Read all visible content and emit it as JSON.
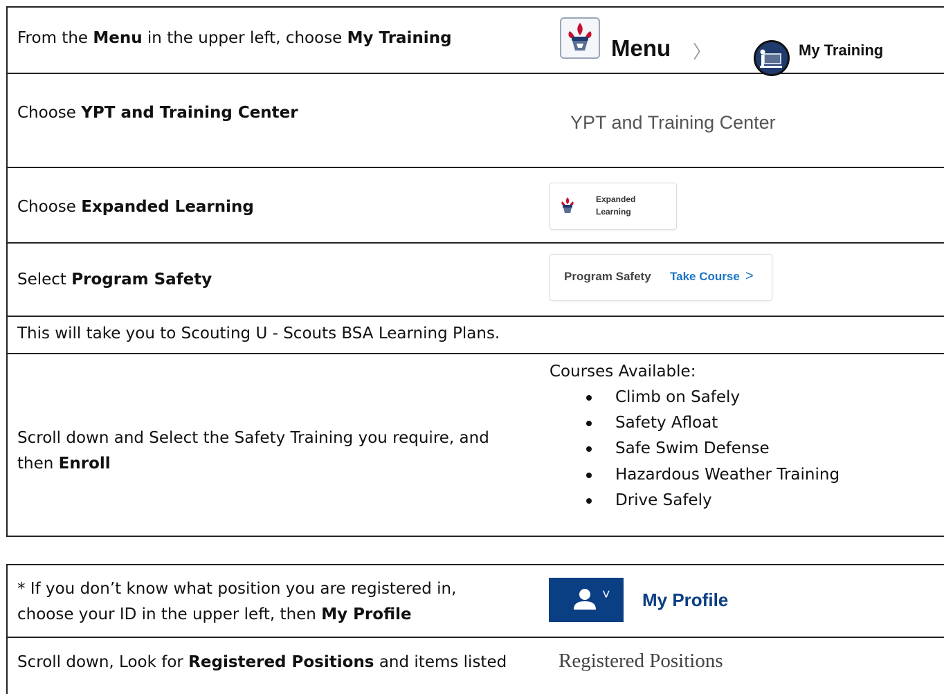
{
  "table1": {
    "rows": [
      {
        "text_parts": [
          "From the ",
          "Menu",
          " in the upper left, choose ",
          "My Training"
        ],
        "menu_label": "Menu",
        "chevron": "〉",
        "training_label": "My Training"
      },
      {
        "text_parts": [
          "Choose ",
          "YPT and Training Center"
        ],
        "visual_text": "YPT and Training Center"
      },
      {
        "text_parts": [
          "Choose ",
          "Expanded Learning"
        ],
        "card_line1": "Expanded",
        "card_line2": "Learning"
      },
      {
        "text_parts": [
          "Select ",
          "Program Safety"
        ],
        "card_title": "Program Safety",
        "card_link": "Take Course",
        "card_chevron": ">"
      },
      {
        "text": "This will take you to Scouting U - Scouts BSA Learning Plans."
      },
      {
        "text_line1": "Scroll down and Select the Safety Training you require, and",
        "text_line2_prefix": "then ",
        "text_line2_bold": "Enroll",
        "courses_heading": "Courses Available:",
        "courses": [
          "Climb on Safely",
          "Safety Afloat",
          "Safe Swim Defense",
          "Hazardous Weather Training",
          "Drive Safely"
        ]
      }
    ]
  },
  "table2": {
    "rows": [
      {
        "text_line1": "* If you don’t know what position you are registered in,",
        "text_line2_prefix": "choose your ID in the upper left, then ",
        "text_line2_bold": "My Profile",
        "profile_label": "My Profile",
        "profile_chevron": "˅"
      },
      {
        "text_prefix": "Scroll down, Look for ",
        "text_bold": "Registered Positions",
        "text_suffix": " and items listed",
        "visual_text": "Registered Positions"
      }
    ]
  },
  "colors": {
    "link_blue": "#1a73c8",
    "profile_blue": "#0b3f84",
    "text_gray": "#555555",
    "bsa_red": "#c8102e",
    "bsa_navy": "#1f3a6d"
  },
  "icons": [
    "bsa-emblem-icon",
    "my-training-icon",
    "user-icon",
    "chevron-right-icon",
    "chevron-down-icon"
  ]
}
